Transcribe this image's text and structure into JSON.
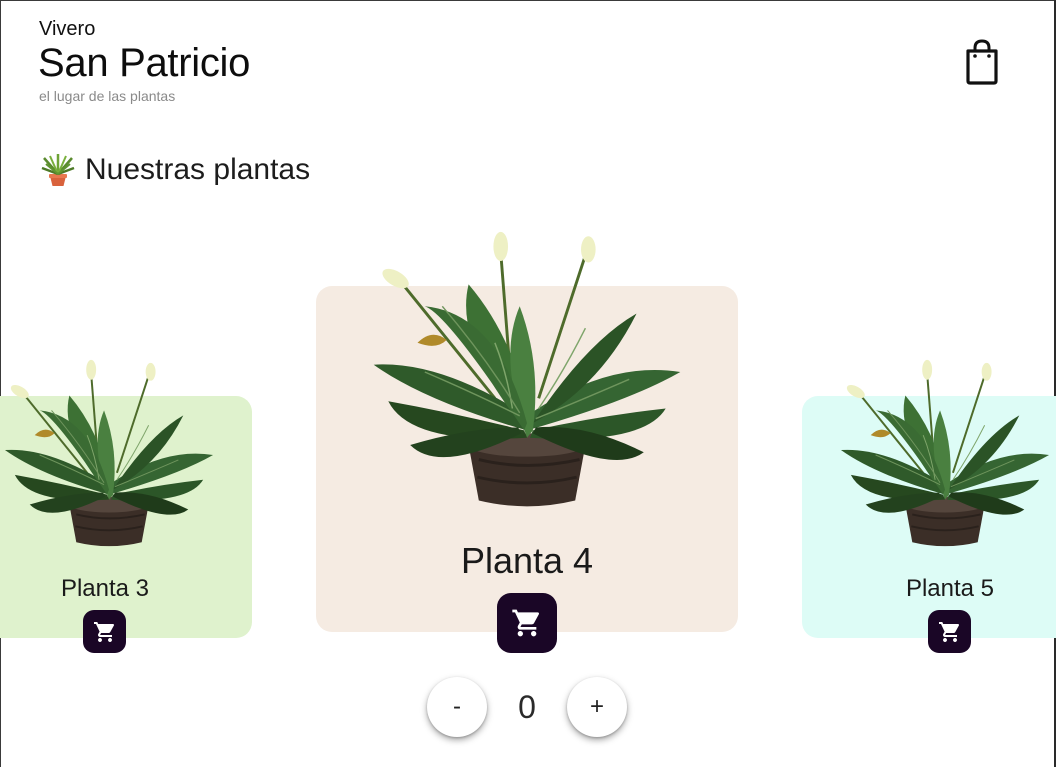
{
  "header": {
    "kicker": "Vivero",
    "title": "San Patricio",
    "tagline": "el lugar de las plantas",
    "bag_icon": "shopping-bag-icon"
  },
  "section": {
    "title": "Nuestras plantas",
    "icon": "potted-plant-icon"
  },
  "carousel": {
    "items": [
      {
        "name": "Planta 3",
        "background": "#dff2cd",
        "cart_icon": "cart-icon"
      },
      {
        "name": "Planta 4",
        "background": "#f5ebe2",
        "cart_icon": "cart-icon"
      },
      {
        "name": "Planta 5",
        "background": "#ddfcf6",
        "cart_icon": "cart-icon"
      }
    ]
  },
  "stepper": {
    "minus_label": "-",
    "value": "0",
    "plus_label": "+"
  },
  "colors": {
    "accent": "#1a0626",
    "tagline": "#8a8a8a"
  }
}
